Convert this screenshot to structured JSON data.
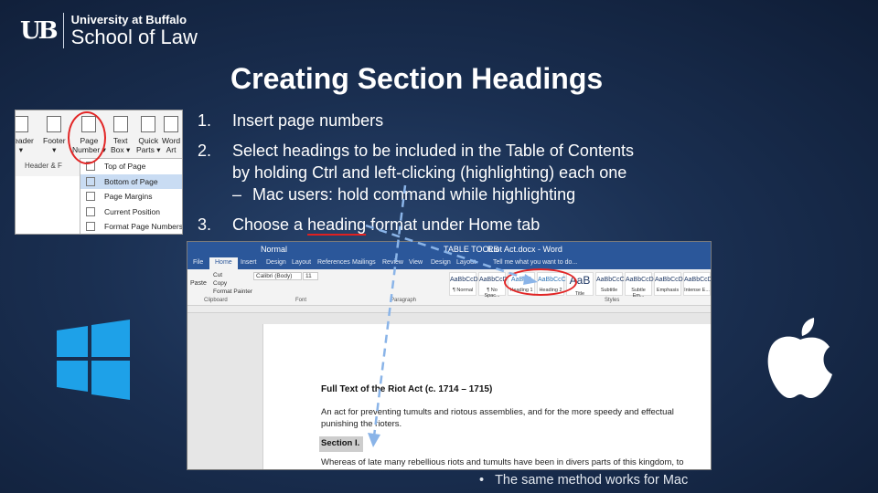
{
  "branding": {
    "mark": "UB",
    "line1": "University at Buffalo",
    "line2": "School of Law"
  },
  "slide": {
    "title": "Creating Section Headings",
    "steps": [
      {
        "num": "1.",
        "text": "Insert page numbers"
      },
      {
        "num": "2.",
        "text": "Select headings to be included in the Table of Contents",
        "text2": "by holding Ctrl and left-clicking (highlighting) each one",
        "sub_dash": "–",
        "sub": "Mac users: hold command while highlighting"
      },
      {
        "num": "3.",
        "text_pre": "Choose a",
        "text_link": "heading",
        "text_post": "format under Home tab"
      }
    ],
    "footnote_bullet": "•",
    "footnote": "The same method works for Mac"
  },
  "page_numbers_screenshot": {
    "ribbon_buttons": [
      {
        "label1": "Header",
        "label2": "▾"
      },
      {
        "label1": "Footer",
        "label2": "▾"
      },
      {
        "label1": "Page",
        "label2": "Number ▾"
      },
      {
        "label1": "Text",
        "label2": "Box ▾"
      },
      {
        "label1": "Quick",
        "label2": "Parts ▾"
      },
      {
        "label1": "Word",
        "label2": "Art"
      }
    ],
    "group_label": "Header & F",
    "menu_items": [
      {
        "label": "Top of Page",
        "arrow": "▸",
        "highlighted": false
      },
      {
        "label": "Bottom of Page",
        "arrow": "▸",
        "highlighted": true
      },
      {
        "label": "Page Margins",
        "arrow": "▸",
        "highlighted": false
      },
      {
        "label": "Current Position",
        "arrow": "▸",
        "highlighted": false
      },
      {
        "label": "Format Page Numbers...",
        "arrow": "",
        "highlighted": false
      }
    ]
  },
  "word_screenshot": {
    "title_left": "Normal",
    "title_mid": "TABLE TOOLS",
    "title_right": "Riot Act.docx - Word",
    "tabs": [
      "File",
      "Home",
      "Insert",
      "Design",
      "Layout",
      "References",
      "Mailings",
      "Review",
      "View",
      "Design",
      "Layout"
    ],
    "tell_me": "Tell me what you want to do...",
    "clipboard": {
      "cut": "Cut",
      "copy": "Copy",
      "format_painter": "Format Painter",
      "paste": "Paste",
      "group": "Clipboard"
    },
    "font": {
      "name": "Calibri (Body)",
      "size": "11",
      "group": "Font"
    },
    "paragraph_group": "Paragraph",
    "styles_group": "Styles",
    "styles": [
      {
        "preview": "AaBbCcDc",
        "name": "¶ Normal"
      },
      {
        "preview": "AaBbCcDc",
        "name": "¶ No Spac..."
      },
      {
        "preview": "AaBbC",
        "name": "Heading 1"
      },
      {
        "preview": "AaBbCcC",
        "name": "Heading 2"
      },
      {
        "preview": "AaB",
        "name": "Title"
      },
      {
        "preview": "AaBbCcC",
        "name": "Subtitle"
      },
      {
        "preview": "AaBbCcDi",
        "name": "Subtle Em..."
      },
      {
        "preview": "AaBbCcDi",
        "name": "Emphasis"
      },
      {
        "preview": "AaBbCcDi",
        "name": "Intense E..."
      }
    ],
    "doc": {
      "heading": "Full Text of the Riot Act (c. 1714 – 1715)",
      "para": "An act for preventing tumults and riotous assemblies, and for the more speedy and effectual punishing the rioters.",
      "section": "Section I.",
      "para2": "Whereas of late many rebellious riots and tumults have been in divers parts of this kingdom, to"
    }
  },
  "icons": {
    "windows": "windows-logo-icon",
    "apple": "apple-logo-icon"
  },
  "colors": {
    "background": "#1a2f51",
    "annotation_red": "#e22626",
    "arrow_blue": "#8ab4e8",
    "word_blue": "#2b579a"
  }
}
